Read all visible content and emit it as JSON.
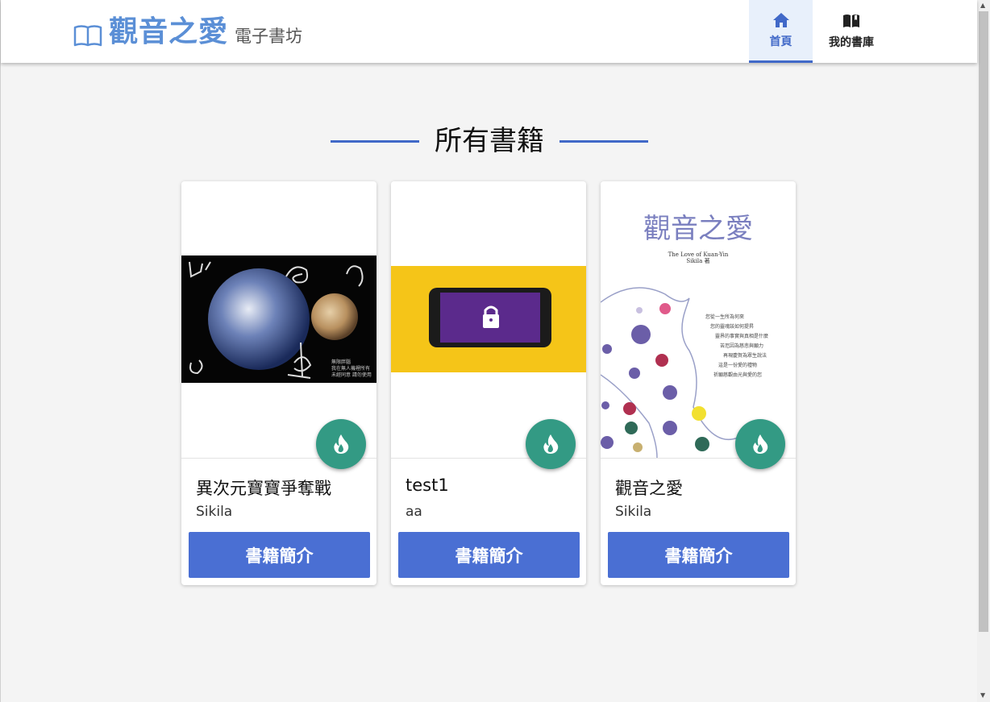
{
  "header": {
    "brand_title": "觀音之愛",
    "brand_subtitle": "電子書坊",
    "nav": [
      {
        "label": "首頁",
        "icon": "home-icon",
        "active": true
      },
      {
        "label": "我的書庫",
        "icon": "book-open-icon",
        "active": false
      }
    ]
  },
  "main": {
    "section_title": "所有書籍",
    "books": [
      {
        "title": "異次元寶寶爭奪戰",
        "author": "Sikila",
        "button_label": "書籍簡介",
        "cover": "earth-mars-cover",
        "cover_text": [
          "無限胖腦",
          "我在無人機裡所有",
          "未經同意 請勿使用"
        ]
      },
      {
        "title": "test1",
        "author": "aa",
        "button_label": "書籍簡介",
        "cover": "phone-lock-cover"
      },
      {
        "title": "觀音之愛",
        "author": "Sikila",
        "button_label": "書籍簡介",
        "cover": "kuan-yin-cover",
        "cover_title": "觀音之愛",
        "cover_subtitle": "The Love of Kuan-Yin",
        "cover_author": "Sikila 著",
        "cover_poem": [
          "您從一生所為何來",
          "您的靈魂該如何提昇",
          "靈界的事實與真相是什麼",
          "苦厄因為慈悲與願力",
          "再現慶賀為眾生說法",
          "這是一份愛的禮物",
          "祈願慈觀由光與愛的您"
        ]
      }
    ]
  },
  "colors": {
    "accent": "#4169c8",
    "button": "#4a6fd3",
    "fab": "#339a84",
    "brand": "#5b8fd6"
  }
}
